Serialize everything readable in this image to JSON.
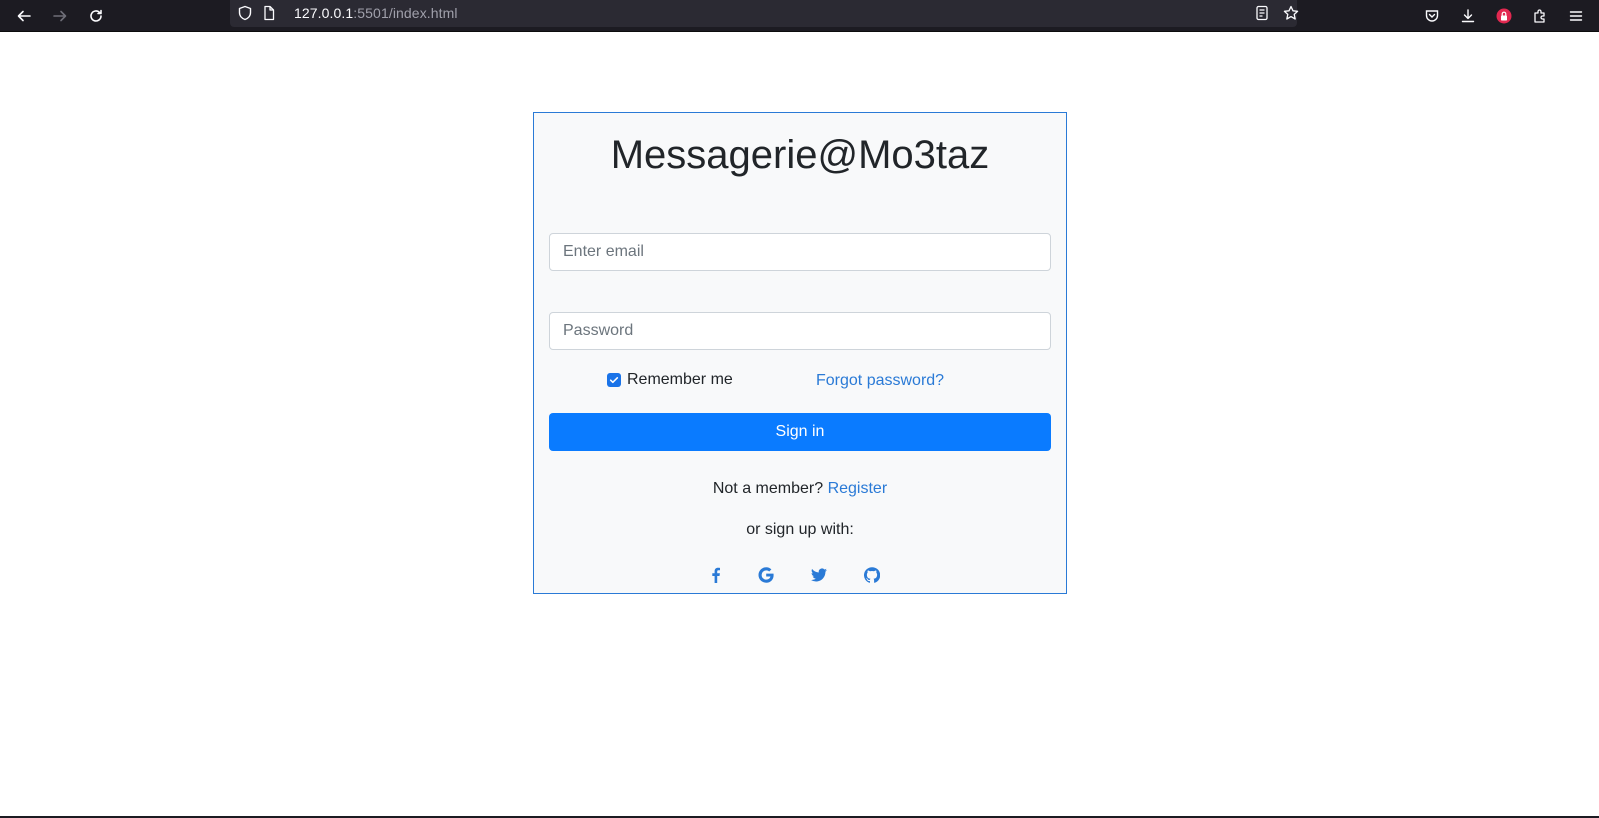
{
  "browser": {
    "url_host": "127.0.0.1",
    "url_rest": ":5501/index.html"
  },
  "page": {
    "title": "Messagerie@Mo3taz",
    "email_placeholder": "Enter email",
    "password_placeholder": "Password",
    "remember_label": "Remember me",
    "remember_checked": true,
    "forgot_label": "Forgot password?",
    "signin_label": "Sign in",
    "member_text": "Not a member? ",
    "register_label": "Register",
    "signup_text": "or sign up with:",
    "social_icons": [
      "facebook-icon",
      "google-icon",
      "twitter-icon",
      "github-icon"
    ]
  },
  "colors": {
    "accent": "#0a7bff",
    "link": "#2a7ad6",
    "card_bg": "#f8f9fa"
  }
}
